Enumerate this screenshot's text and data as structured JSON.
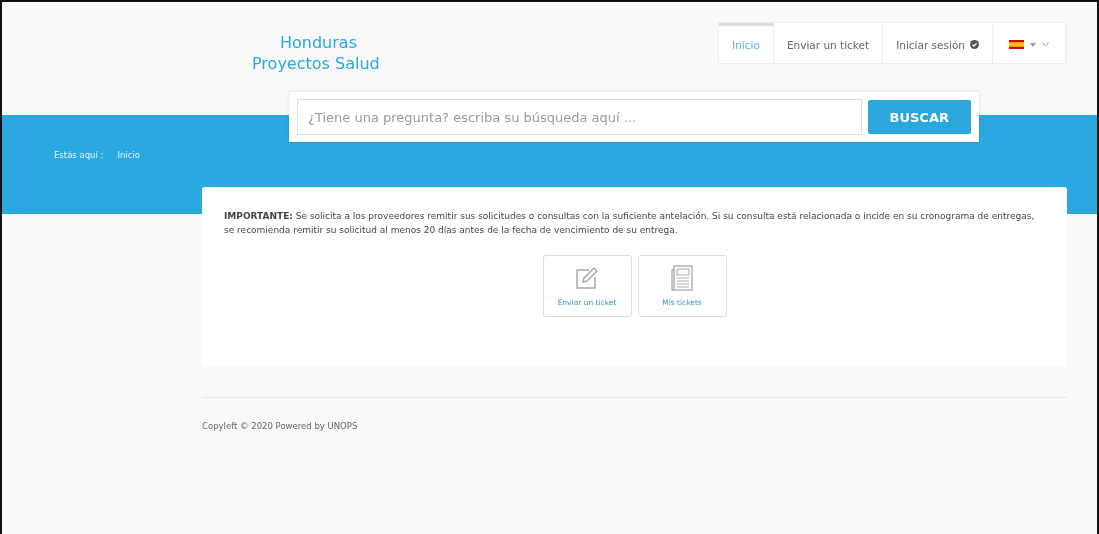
{
  "brand": {
    "lines": [
      "Honduras",
      "Proyectos Salud"
    ]
  },
  "nav": [
    {
      "label": "Inicio",
      "selected": true,
      "kind": "link"
    },
    {
      "label": "Enviar un ticket",
      "selected": false,
      "kind": "link"
    },
    {
      "label": "Iniciar sesión",
      "selected": false,
      "kind": "login"
    },
    {
      "selected": false,
      "kind": "language"
    }
  ],
  "search": {
    "placeholder": "¿Tiene una pregunta? escriba su búsqueda aquí ...",
    "button": "BUSCAR"
  },
  "breadcrumb": {
    "label": "Estás aquí :",
    "items": [
      "Inicio"
    ]
  },
  "notice": "**IMPORTANTE:** Se solicita a los proveedores remitir sus solicitudes o consultas con la suficiente antelación. Si su consulta está relacionada o incide en su cronograma de entregas, se recomienda remitir su solicitud al menos 20 días antes de la fecha de vencimiento de su entrega.",
  "actions": [
    {
      "label": "Enviar un ticket",
      "kind": "edit"
    },
    {
      "label": "Mis tickets",
      "kind": "list"
    }
  ],
  "footer": {
    "text": "Copyleft © 2020 Powered by UNOPS"
  }
}
